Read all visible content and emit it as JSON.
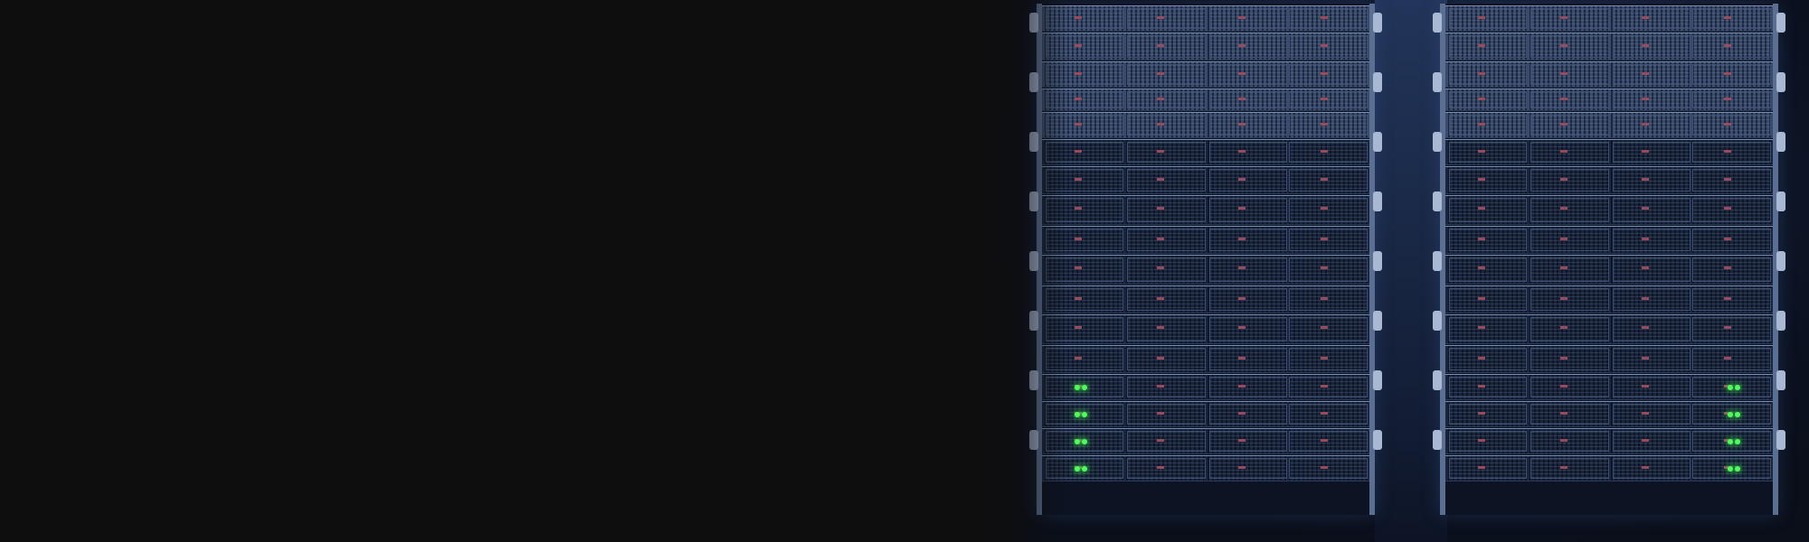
{
  "scene": {
    "description_label": "",
    "colors": {
      "left_background": "#0e0e0f",
      "photo_tint": "#1d2d4c",
      "rack_frame": "#5a6f92",
      "status_led": "#4dff5a"
    },
    "racks": [
      {
        "name": "rack-left",
        "server_count": 17
      },
      {
        "name": "rack-right",
        "server_count": 17
      }
    ]
  }
}
